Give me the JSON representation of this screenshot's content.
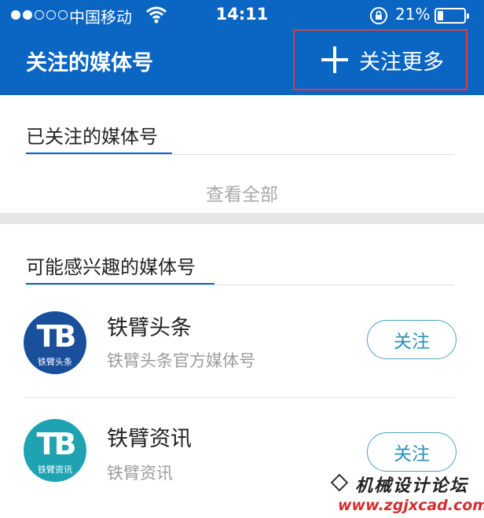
{
  "status_bar": {
    "carrier": "中国移动",
    "time": "14:11",
    "battery": "21%",
    "battery_level": 0.21,
    "signal_bars_filled": 2,
    "signal_bars_total": 5
  },
  "header": {
    "title": "关注的媒体号",
    "follow_more_label": "关注更多"
  },
  "followed": {
    "title": "已关注的媒体号",
    "view_all": "查看全部"
  },
  "suggested": {
    "title": "可能感兴趣的媒体号",
    "items": [
      {
        "name": "铁臂头条",
        "description": "铁臂头条官方媒体号",
        "button": "关注",
        "logo_text": "TB",
        "logo_caption": "铁臂头条",
        "logo_color": "#1a4f9c"
      },
      {
        "name": "铁臂资讯",
        "description": "铁臂资讯",
        "button": "关注",
        "logo_text": "TB",
        "logo_caption": "铁臂资讯",
        "logo_color": "#1fa3b3"
      }
    ]
  },
  "watermark": {
    "line1": "机械设计论坛",
    "line2": "www.zgjxcad.com"
  },
  "colors": {
    "brand_blue": "#0a66c2",
    "highlight_border": "#e53935",
    "follow_button": "#2a8fb8"
  }
}
